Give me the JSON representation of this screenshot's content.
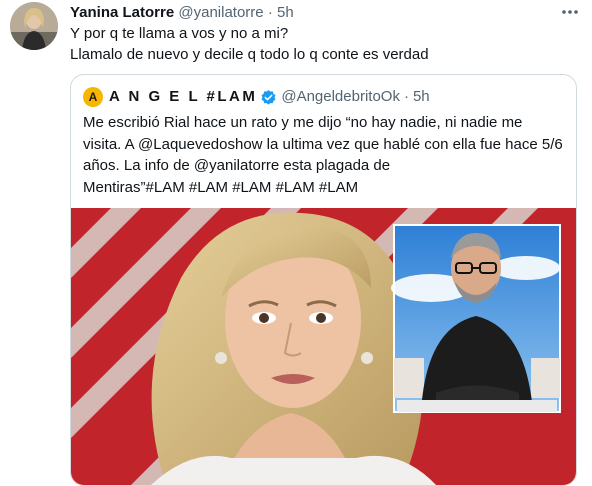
{
  "tweet": {
    "author_name": "Yanina Latorre",
    "author_handle": "@yanilatorre",
    "separator": "·",
    "time": "5h",
    "more_icon": "more-horizontal-icon",
    "text_lines": [
      "Y por q te llama a vos y no a mi?",
      "Llamalo de nuevo y decile q todo lo q conte es verdad"
    ]
  },
  "quote": {
    "avatar_letter": "A",
    "author_name": "A N G E L #LAM",
    "verified_icon": "verified-badge-icon",
    "author_handle": "@AngeldebritoOk",
    "separator": "·",
    "time": "5h",
    "text_lines": [
      "Me escribió Rial hace un rato y me dijo “no hay nadie, ni nadie me",
      "visita. A @Laquevedoshow la ultima vez que hablé con ella fue hace 5/6",
      "años. La info de @yanilatorre esta plagada de",
      "Mentiras”#LAM #LAM #LAM #LAM #LAM"
    ]
  },
  "colors": {
    "text": "#0f1419",
    "secondary": "#536471",
    "verified": "#1d9bf0",
    "border": "#cfd9de",
    "media_red": "#c2242b"
  }
}
